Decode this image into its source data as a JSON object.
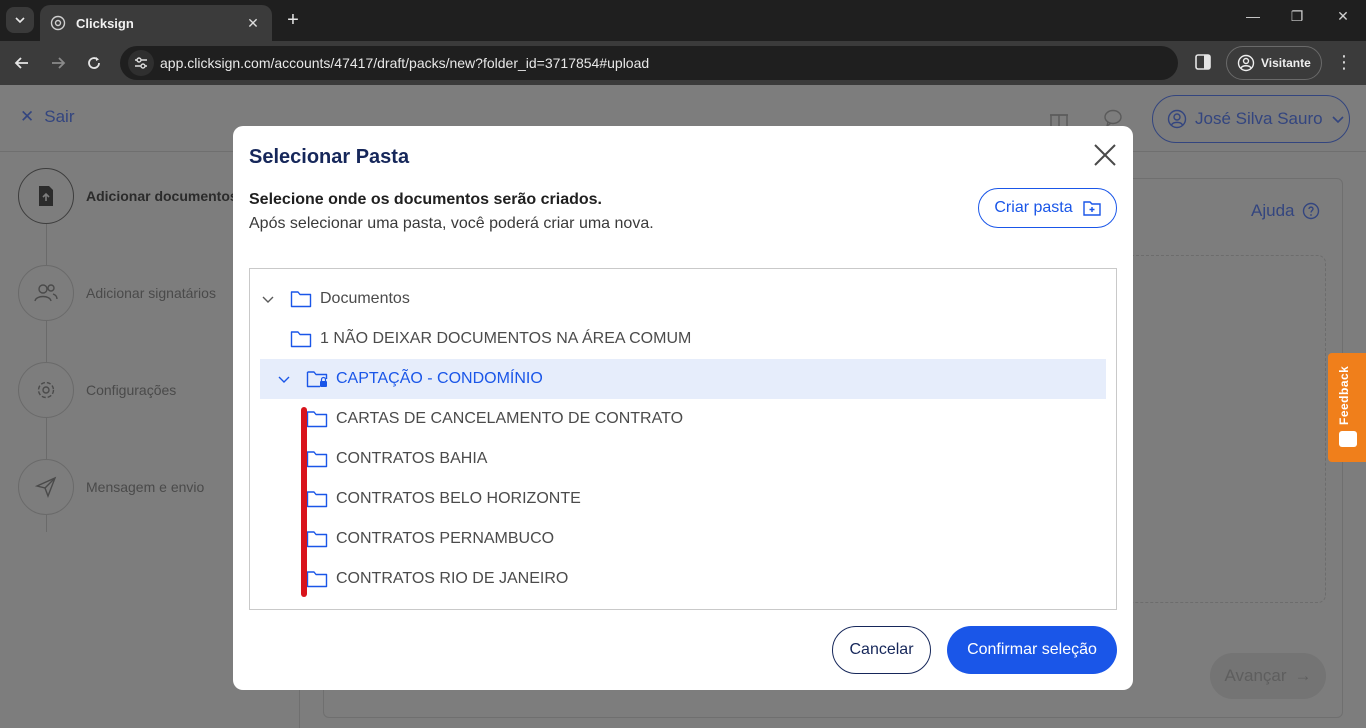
{
  "browser": {
    "tab_title": "Clicksign",
    "url": "app.clicksign.com/accounts/47417/draft/packs/new?folder_id=3717854#upload",
    "profile_label": "Visitante"
  },
  "page": {
    "sair_label": "Sair",
    "user_name": "José Silva Sauro",
    "ajuda_label": "Ajuda",
    "avancar_label": "Avançar",
    "feedback_label": "Feedback",
    "steps": [
      {
        "label": "Adicionar documentos",
        "icon": "upload-file-icon",
        "active": true
      },
      {
        "label": "Adicionar signatários",
        "icon": "users-icon",
        "active": false
      },
      {
        "label": "Configurações",
        "icon": "gear-icon",
        "active": false
      },
      {
        "label": "Mensagem e envio",
        "icon": "send-icon",
        "active": false
      }
    ]
  },
  "modal": {
    "title": "Selecionar Pasta",
    "desc_strong": "Selecione onde os documentos serão criados.",
    "desc": "Após selecionar uma pasta, você poderá criar uma nova.",
    "criar_label": "Criar pasta",
    "cancel_label": "Cancelar",
    "confirm_label": "Confirmar seleção",
    "tree": [
      {
        "label": "Documentos",
        "level": 0,
        "expanded": true,
        "selected": false,
        "locked": false
      },
      {
        "label": "1 NÃO DEIXAR DOCUMENTOS NA ÁREA COMUM",
        "level": 1,
        "expanded": false,
        "selected": false,
        "locked": false
      },
      {
        "label": "CAPTAÇÃO - CONDOMÍNIO",
        "level": 1,
        "expanded": true,
        "selected": true,
        "locked": true
      },
      {
        "label": "CARTAS DE CANCELAMENTO DE CONTRATO",
        "level": 2,
        "expanded": false,
        "selected": false,
        "locked": false
      },
      {
        "label": "CONTRATOS BAHIA",
        "level": 2,
        "expanded": false,
        "selected": false,
        "locked": false
      },
      {
        "label": "CONTRATOS BELO HORIZONTE",
        "level": 2,
        "expanded": false,
        "selected": false,
        "locked": false
      },
      {
        "label": "CONTRATOS PERNAMBUCO",
        "level": 2,
        "expanded": false,
        "selected": false,
        "locked": false
      },
      {
        "label": "CONTRATOS RIO DE JANEIRO",
        "level": 2,
        "expanded": false,
        "selected": false,
        "locked": false
      }
    ]
  },
  "colors": {
    "primary": "#1a56e8",
    "navy": "#16275a",
    "selected_bg": "#e6edfb",
    "annotation_red": "#d8141c",
    "feedback": "#f07f1b"
  }
}
